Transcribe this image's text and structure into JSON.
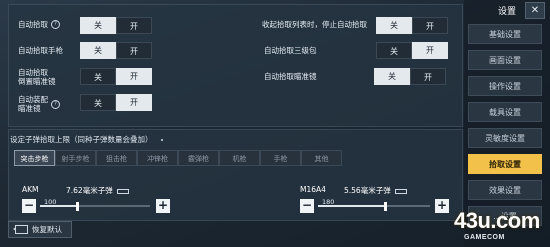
{
  "sidebar": {
    "title": "设置",
    "close_icon": "close-icon",
    "items": [
      {
        "label": "基础设置",
        "active": false
      },
      {
        "label": "画面设置",
        "active": false
      },
      {
        "label": "操作设置",
        "active": false
      },
      {
        "label": "载具设置",
        "active": false
      },
      {
        "label": "灵敏度设置",
        "active": false
      },
      {
        "label": "拾取设置",
        "active": true
      },
      {
        "label": "效果设置",
        "active": false
      },
      {
        "label": "...设置",
        "active": false
      }
    ],
    "accent_color": "#f2c14a"
  },
  "pickup_toggles": [
    {
      "label": "自动拾取",
      "has_help": true,
      "off_label": "关",
      "on_label": "开",
      "state": "off"
    },
    {
      "label": "收起拾取列表时，停止自动拾取",
      "has_help": false,
      "off_label": "关",
      "on_label": "开",
      "state": "off"
    },
    {
      "label": "自动拾取手枪",
      "has_help": false,
      "off_label": "关",
      "on_label": "开",
      "state": "off"
    },
    {
      "label": "自动拾取三级包",
      "has_help": false,
      "off_label": "关",
      "on_label": "开",
      "state": "on"
    },
    {
      "label": "自动拾取\n倒置瞄准镜",
      "has_help": false,
      "off_label": "关",
      "on_label": "开",
      "state": "on"
    },
    {
      "label": "自动拾取瞄准镜",
      "has_help": false,
      "off_label": "关",
      "on_label": "开",
      "state": "off"
    },
    {
      "label": "自动装配\n瞄准镜",
      "has_help": true,
      "off_label": "关",
      "on_label": "开",
      "state": "on"
    }
  ],
  "ammo_limit": {
    "title": "设定子弹拾取上限（同种子弹数量会叠加）",
    "tabs": [
      "突击步枪",
      "射手步枪",
      "狙击枪",
      "冲锋枪",
      "霰弹枪",
      "机枪",
      "手枪",
      "其他"
    ],
    "active_tab": 0,
    "weapons": [
      {
        "name": "AKM",
        "ammo": "7.62毫米子弹",
        "value": 100,
        "max": 300,
        "minus": "−",
        "plus": "+"
      },
      {
        "name": "M16A4",
        "ammo": "5.56毫米子弹",
        "value": 180,
        "max": 300,
        "minus": "−",
        "plus": "+"
      }
    ]
  },
  "restore_button": {
    "label": "恢复默认",
    "icon": "back-icon"
  },
  "watermark": {
    "main": "43u.com",
    "sub": "GAMECOM"
  }
}
